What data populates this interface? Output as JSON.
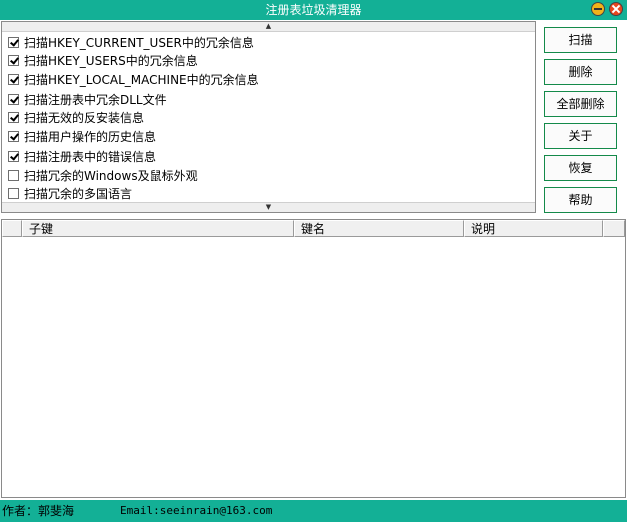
{
  "window": {
    "title": "注册表垃圾清理器",
    "min_icon": "minimize-icon",
    "close_icon": "close-icon",
    "accent_color": "#13b096"
  },
  "options": [
    {
      "label": "扫描HKEY_CURRENT_USER中的冗余信息",
      "checked": true
    },
    {
      "label": "扫描HKEY_USERS中的冗余信息",
      "checked": true
    },
    {
      "label": "扫描HKEY_LOCAL_MACHINE中的冗余信息",
      "checked": true
    },
    {
      "label": "扫描注册表中冗余DLL文件",
      "checked": true
    },
    {
      "label": "扫描无效的反安装信息",
      "checked": true
    },
    {
      "label": "扫描用户操作的历史信息",
      "checked": true
    },
    {
      "label": "扫描注册表中的错误信息",
      "checked": true
    },
    {
      "label": "扫描冗余的Windows及鼠标外观",
      "checked": false
    },
    {
      "label": "扫描冗余的多国语言",
      "checked": false
    }
  ],
  "buttons": {
    "scan": "扫描",
    "delete": "删除",
    "delete_all": "全部删除",
    "about": "关于",
    "restore": "恢复",
    "help": "帮助"
  },
  "table": {
    "columns": [
      "子键",
      "键名",
      "说明"
    ]
  },
  "status": {
    "author": "作者：郭斐海",
    "email": "Email:seeinrain@163.com"
  }
}
